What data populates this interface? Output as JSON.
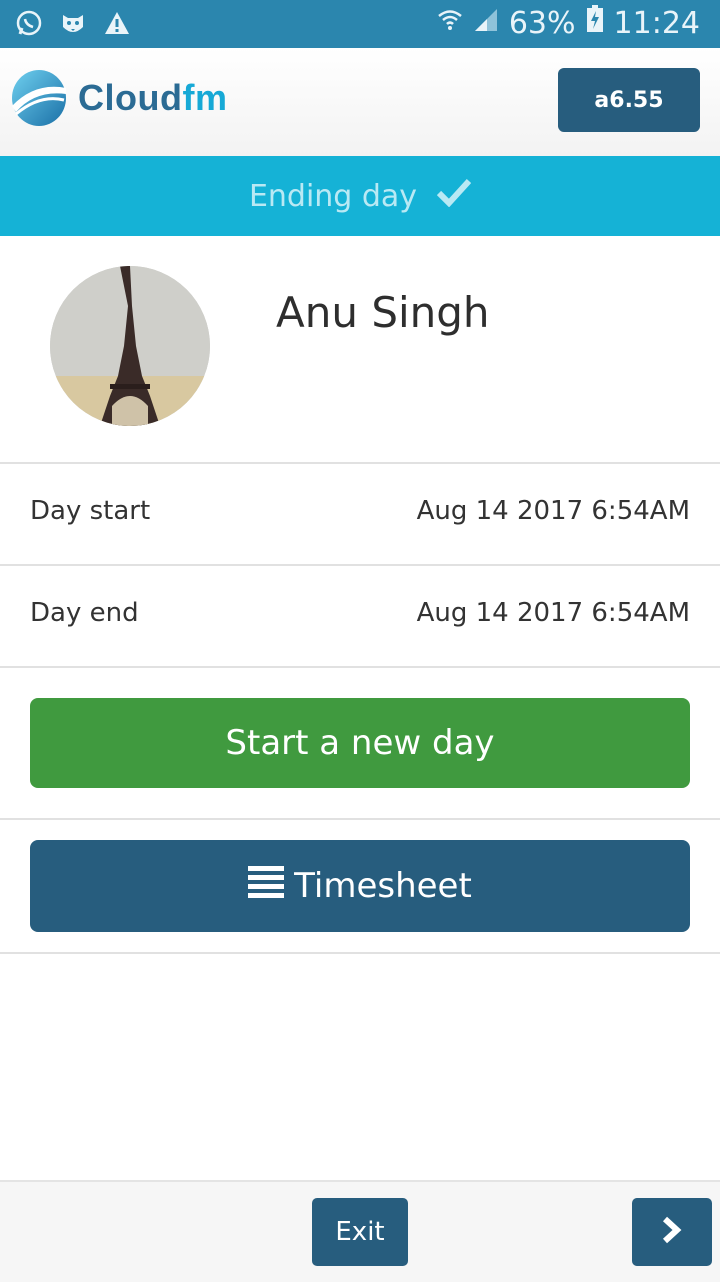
{
  "status_bar": {
    "battery": "63%",
    "time": "11:24",
    "icons": [
      "whatsapp-icon",
      "tiger-icon",
      "warning-icon",
      "wifi-icon",
      "signal-icon",
      "battery-charging-icon"
    ]
  },
  "header": {
    "logo_text_primary": "Cloud",
    "logo_text_accent": "fm",
    "version_label": "a6.55"
  },
  "banner": {
    "text": "Ending day",
    "icon": "checkmark-icon"
  },
  "profile": {
    "name": "Anu Singh"
  },
  "rows": [
    {
      "label": "Day start",
      "value": "Aug 14 2017 6:54AM"
    },
    {
      "label": "Day end",
      "value": "Aug 14 2017 6:54AM"
    }
  ],
  "buttons": {
    "start_new_day": "Start a new day",
    "timesheet": "Timesheet"
  },
  "footer": {
    "exit_label": "Exit",
    "next_icon": "chevron-right-icon"
  },
  "colors": {
    "status_bar": "#2b86ae",
    "banner": "#15b2d6",
    "primary": "#275d7e",
    "success": "#409a3f"
  }
}
